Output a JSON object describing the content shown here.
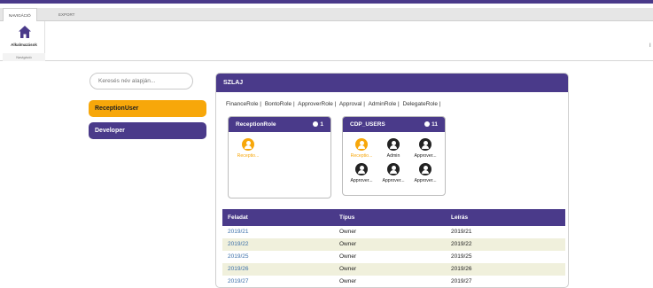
{
  "ribbon": {
    "tabs": [
      "NAVIGÁCIÓ",
      "EXPORT"
    ],
    "button_label": "Alkalmazások",
    "group_label": "Navigáció",
    "corner_mark": "I"
  },
  "search": {
    "placeholder": "Keresés név alapján..."
  },
  "left_buttons": [
    {
      "label": "ReceptionUser",
      "selected": true
    },
    {
      "label": "Developer",
      "selected": false
    }
  ],
  "panel": {
    "title": "SZLAJ",
    "roles": [
      "FinanceRole |",
      "BontoRole |",
      "ApproverRole |",
      "Approval |",
      "AdminRole |",
      "DelegateRole |"
    ],
    "cards": [
      {
        "title": "ReceptionRole",
        "count": "1",
        "members": [
          {
            "name": "Receptio...",
            "color": "orange"
          }
        ]
      },
      {
        "title": "CDP_USERS",
        "count": "11",
        "members": [
          {
            "name": "Receptio...",
            "color": "orange"
          },
          {
            "name": "Admin",
            "color": "dark"
          },
          {
            "name": "Approver...",
            "color": "dark"
          },
          {
            "name": "Approver...",
            "color": "dark"
          },
          {
            "name": "Approver...",
            "color": "dark"
          },
          {
            "name": "Approver...",
            "color": "dark"
          }
        ]
      }
    ],
    "table": {
      "headers": [
        "Feladat",
        "Típus",
        "Leírás"
      ],
      "rows": [
        [
          "2019/21",
          "Owner",
          "2019/21"
        ],
        [
          "2019/22",
          "Owner",
          "2019/22"
        ],
        [
          "2019/25",
          "Owner",
          "2019/25"
        ],
        [
          "2019/26",
          "Owner",
          "2019/26"
        ],
        [
          "2019/27",
          "Owner",
          "2019/27"
        ]
      ]
    }
  },
  "colors": {
    "primary": "#4a3a8a",
    "accent": "#f7a70a",
    "row_alt": "#f0f0dc",
    "link": "#3a6ea8"
  },
  "icons": {
    "home": "home-icon",
    "user": "user-icon",
    "users_count": "user-count-icon"
  }
}
